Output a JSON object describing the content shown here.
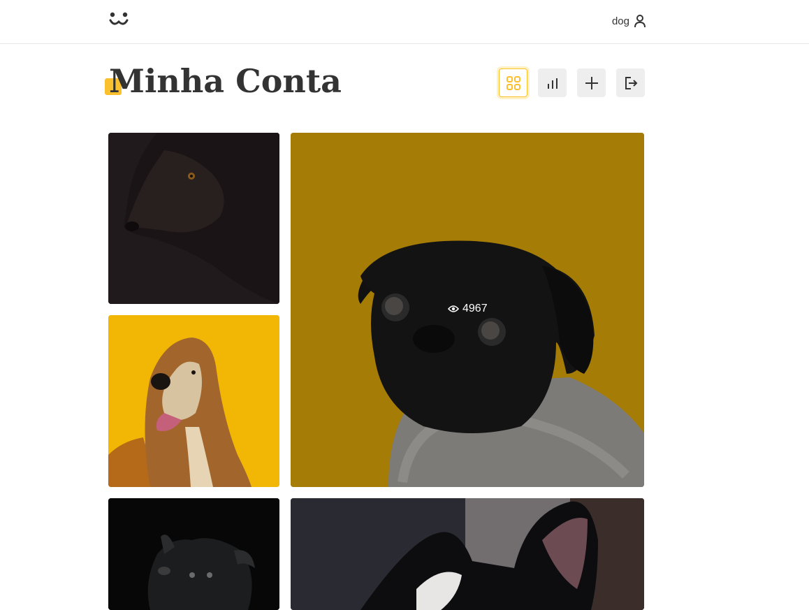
{
  "header": {
    "logo_icon": "dog-face-logo-icon",
    "username": "dog",
    "user_icon": "user-icon"
  },
  "page": {
    "title": "Minha Conta"
  },
  "toolbar": {
    "buttons": [
      {
        "icon": "grid-feed-icon",
        "active": true
      },
      {
        "icon": "bar-chart-stats-icon",
        "active": false
      },
      {
        "icon": "plus-post-icon",
        "active": false
      },
      {
        "icon": "logout-icon",
        "active": false
      }
    ],
    "accent_color": "#fbc02d"
  },
  "feed": {
    "photos": [
      {
        "subject": "black dog profile on dark background",
        "bg": "#211a1c"
      },
      {
        "subject": "black pug in grey sweater on mustard background",
        "bg": "#a57c05",
        "views": "4967"
      },
      {
        "subject": "afghan hound on yellow background",
        "bg": "#f2b705"
      },
      {
        "subject": "black dog looking up on black background",
        "bg": "#070707"
      },
      {
        "subject": "black and white french bulldog",
        "bg": "#2a2a32"
      }
    ]
  }
}
